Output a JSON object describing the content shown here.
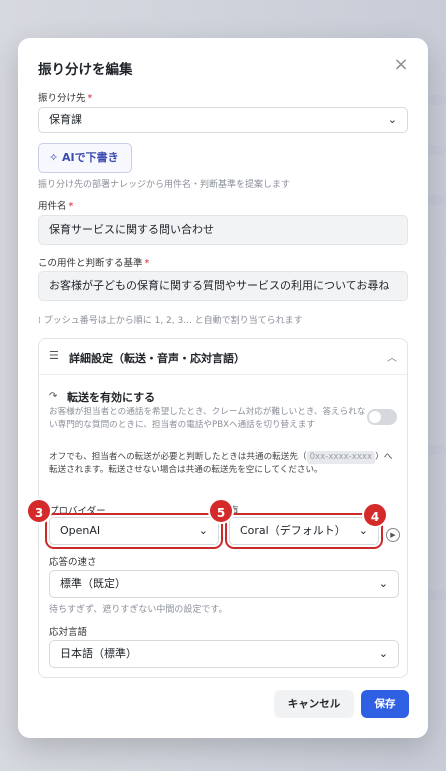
{
  "modal": {
    "title": "振り分けを編集",
    "close_symbol": "×"
  },
  "destination": {
    "label": "振り分け先",
    "required_mark": "*",
    "value": "保育課"
  },
  "ai_draft": {
    "label": "AIで下書き",
    "hint": "振り分け先の部署ナレッジから用件名・判断基準を提案します"
  },
  "subject": {
    "label": "用件名",
    "required_mark": "*",
    "value": "保育サービスに関する問い合わせ"
  },
  "criteria": {
    "label": "この用件と判断する基準",
    "required_mark": "*",
    "value": "お客様が子どもの保育に関する質問やサービスの利用についてお尋ね"
  },
  "push_hint": "プッシュ番号は上から順に 1, 2, 3... と自動で割り当てられます",
  "advanced": {
    "title": "詳細設定（転送・音声・応対言語）",
    "transfer_title": "転送を有効にする",
    "transfer_desc": "お客様が担当者との通話を希望したとき、クレーム対応が難しいとき、答えられない専門的な質問のときに、担当者の電話やPBXへ通話を切り替えます",
    "transfer_enabled": false,
    "off_desc_1": "オフでも、担当者への転送が必要と判断したときは共通の転送先",
    "off_desc_open": "（",
    "tel": "0xx-xxxx-xxxx",
    "off_desc_2": "）へ転送されます。転送させない場合は共通の転送先を空にしてください。",
    "provider_label": "プロバイダー",
    "provider_value": "OpenAI",
    "voice_label": "声",
    "voice_value": "Coral（デフォルト）",
    "speed_label": "応答の速さ",
    "speed_value": "標準（既定）",
    "speed_hint": "待ちすぎず、遮りすぎない中間の設定です。",
    "language_label": "応対言語",
    "language_value": "日本語（標準）"
  },
  "badges": {
    "provider": "3",
    "voice": "5",
    "preview": "4"
  },
  "footer": {
    "cancel": "キャンセル",
    "save": "保存"
  },
  "colors": {
    "primary": "#2f5fe3",
    "highlight": "#cc2a2a",
    "required": "#d1242f"
  }
}
